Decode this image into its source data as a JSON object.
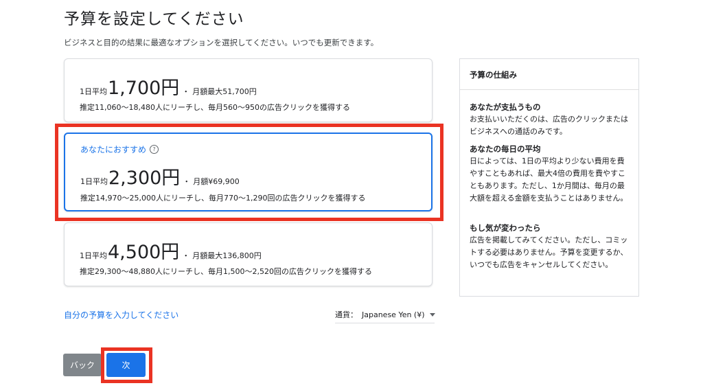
{
  "header": {
    "title": "予算を設定してください",
    "subtitle": "ビジネスと目的の結果に最適なオプションを選択してください。いつでも更新できます。"
  },
  "options": [
    {
      "recommended_label": "",
      "prefix": "1日平均",
      "amount": "1,700円",
      "separator": "・",
      "monthly": "月額最大51,700円",
      "reach": "推定11,060〜18,480人にリーチし、毎月560〜950の広告クリックを獲得する"
    },
    {
      "recommended_label": "あなたにおすすめ",
      "prefix": "1日平均",
      "amount": "2,300円",
      "separator": "・",
      "monthly": "月額¥69,900",
      "reach": "推定14,970〜25,000人にリーチし、毎月770〜1,290回の広告クリックを獲得する"
    },
    {
      "recommended_label": "",
      "prefix": "1日平均",
      "amount": "4,500円",
      "separator": "・",
      "monthly": "月額最大136,800円",
      "reach": "推定29,300〜48,880人にリーチし、毎月1,500〜2,520回の広告クリックを獲得する"
    }
  ],
  "help_icon_glyph": "?",
  "info_panel": {
    "title": "予算の仕組み",
    "sections": [
      {
        "heading": "あなたが支払うもの",
        "body": "お支払いいただくのは、広告のクリックまたはビジネスへの通話のみです。"
      },
      {
        "heading": "あなたの毎日の平均",
        "body": "日によっては、1日の平均より少ない費用を費やすこともあれば、最大4倍の費用を費やすこともあります。ただし、1か月間は、毎月の最大額を超える金額を支払うことはありません。"
      },
      {
        "heading": "もし気が変わったら",
        "body": "広告を掲載してみてください。ただし、コミットする必要はありません。予算を変更するか、いつでも広告をキャンセルしてください。"
      }
    ]
  },
  "custom_budget_link": "自分の予算を入力してください",
  "currency": {
    "label": "通貨：",
    "value": "Japanese Yen (¥)"
  },
  "buttons": {
    "back": "バック",
    "next": "次"
  },
  "colors": {
    "accent": "#1a73e8",
    "highlight": "#ea3323",
    "back_button": "#80868b"
  }
}
